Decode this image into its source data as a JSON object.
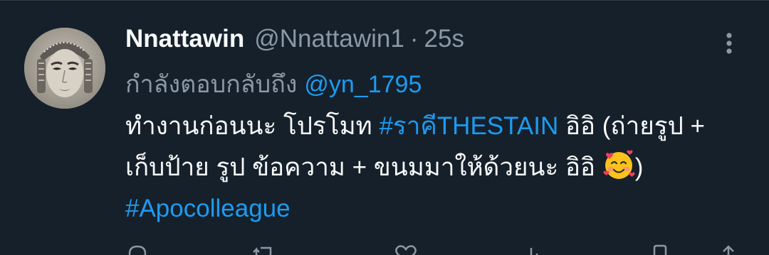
{
  "user": {
    "display_name": "Nnattawin",
    "handle": "@Nnattawin1",
    "separator": "·",
    "time": "25s"
  },
  "reply": {
    "prefix": "กำลังตอบกลับถึง",
    "mention": "@yn_1795"
  },
  "tweet": {
    "text_part1": "ทำงานก่อนนะ โปรโมท ",
    "hashtag1": "#ราคีTHESTAIN",
    "text_part2": " อิอิ (ถ่ายรูป + เก็บป้าย รูป ข้อความ + ขนมมาให้ด้วยนะ อิอิ ",
    "text_part3": ") ",
    "hashtag2": "#Apocolleague",
    "emoji": "smiling-face-with-hearts-icon"
  },
  "colors": {
    "background": "#15202b",
    "primary_text": "#f7f9f9",
    "secondary_text": "#8b98a5",
    "link": "#1d9bf0"
  },
  "actions": [
    "reply-icon",
    "retweet-icon",
    "like-icon",
    "views-icon",
    "bookmark-icon",
    "share-icon"
  ]
}
